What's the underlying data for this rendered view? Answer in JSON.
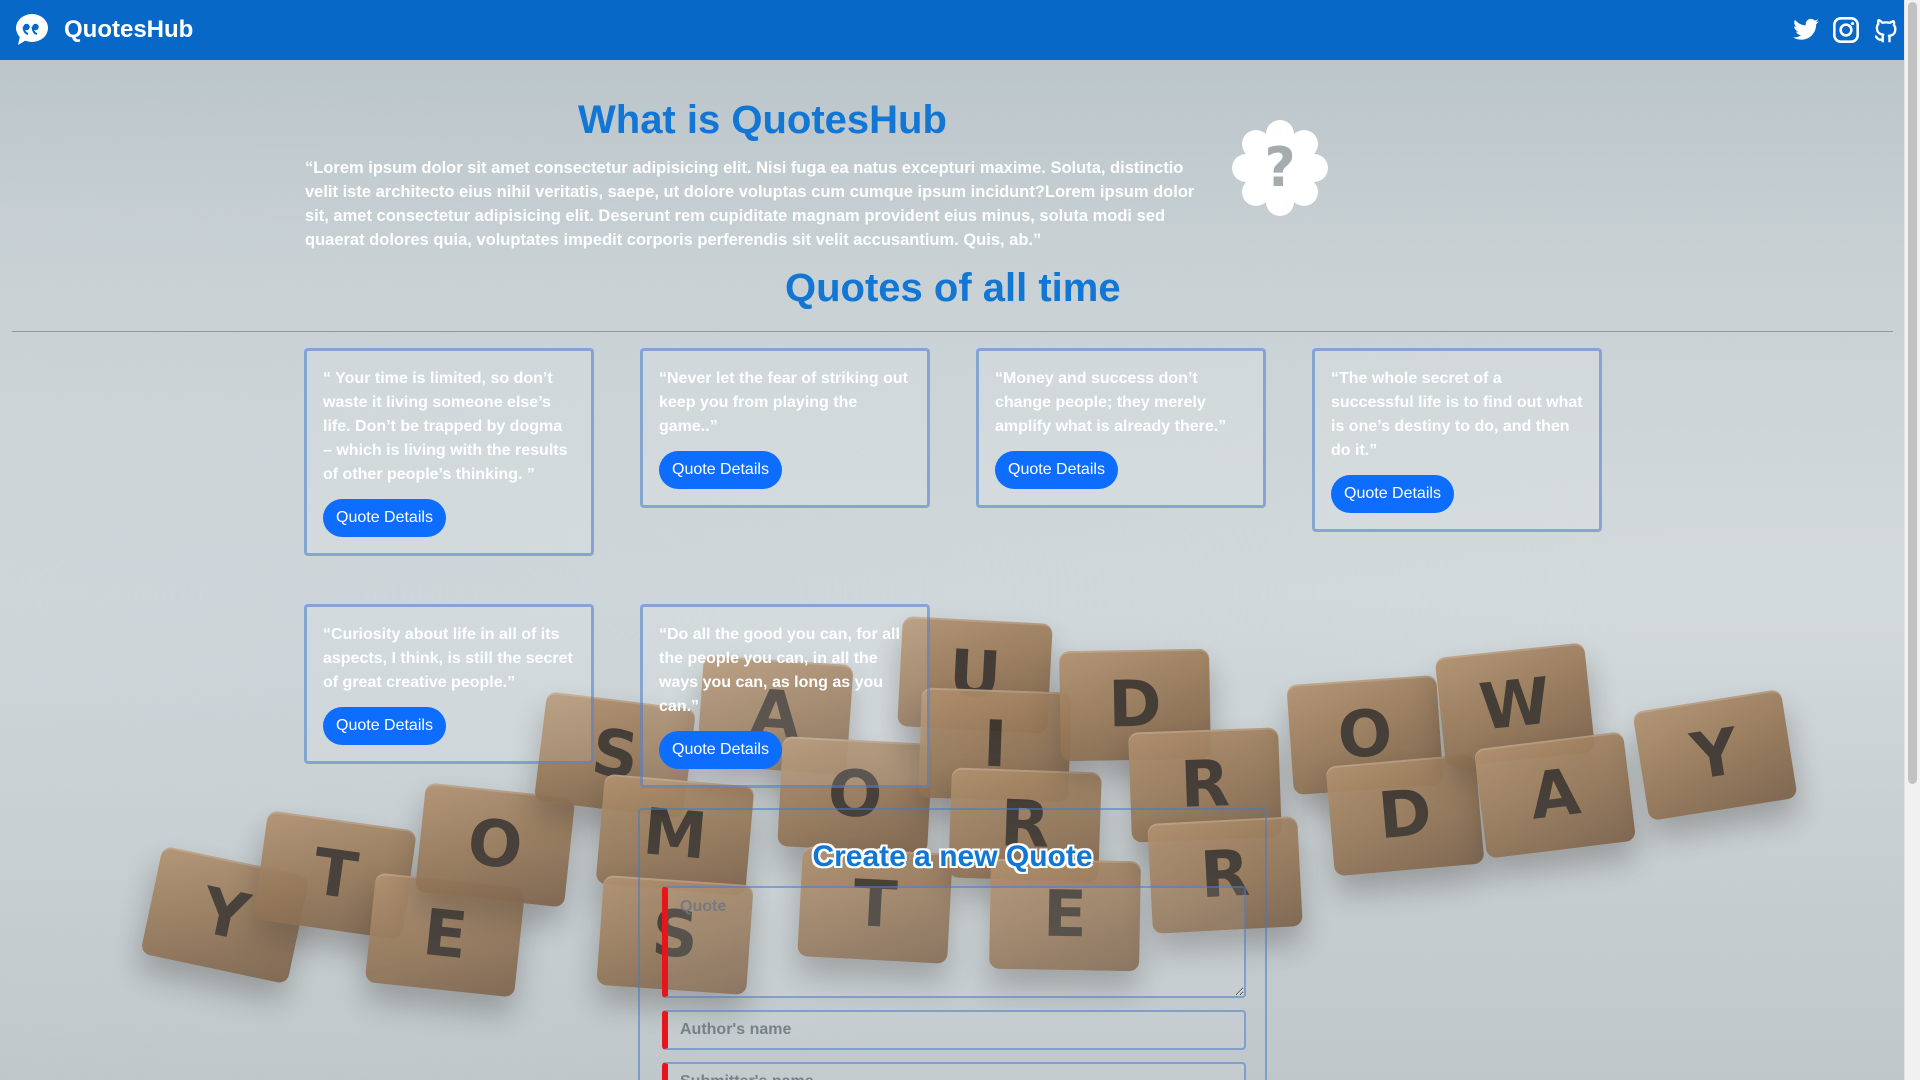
{
  "navbar": {
    "brand": "QuotesHub",
    "icons": [
      "speech-bubble-icon",
      "twitter-icon",
      "instagram-icon",
      "github-icon"
    ],
    "color": "#0868c8"
  },
  "about": {
    "title": "What is QuotesHub",
    "text": "“Lorem ipsum dolor sit amet consectetur adipisicing elit. Nisi fuga ea natus excepturi maxime. Soluta, distinctio velit iste architecto eius nihil veritatis, saepe, ut dolore voluptas cum cumque ipsum incidunt?Lorem ipsum dolor sit, amet consectetur adipisicing elit. Deserunt rem cupiditate magnam provident eius minus, soluta modi sed quaerat dolores quia, voluptates impedit corporis perferendis sit velit accusantium. Quis, ab.”",
    "badge_icon": "question-badge-icon"
  },
  "quotes_section": {
    "title": "Quotes of all time",
    "button_label": "Quote Details",
    "quotes": [
      "“ Your time is limited, so don’t waste it living someone else’s life. Don’t be trapped by dogma – which is living with the results of other people’s thinking. ”",
      "“Never let the fear of striking out keep you from playing the game..”",
      "“Money and success don’t change people; they merely amplify what is already there.”",
      "“The whole secret of a successful life is to find out what is one’s destiny to do, and then do it.”",
      "“Curiosity about life in all of its aspects, I think, is still the secret of great creative people.”",
      "“Do all the good you can, for all the people you can, in all the ways you can, as long as you can.”"
    ]
  },
  "form": {
    "title": "Create a new Quote",
    "quote_placeholder": "Quote",
    "author_placeholder": "Author's name",
    "submitter_placeholder": "Submitter's name"
  },
  "colors": {
    "accent": "#1176d4",
    "button": "#0d6efd",
    "required_marker": "#e8141c"
  }
}
